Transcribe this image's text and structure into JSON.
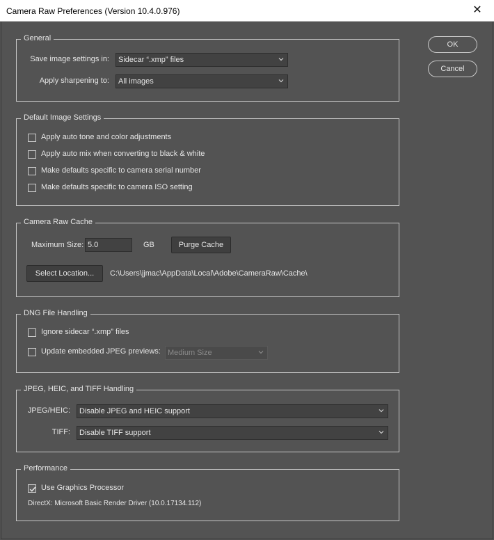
{
  "window": {
    "title": "Camera Raw Preferences  (Version 10.4.0.976)",
    "close_glyph": "✕"
  },
  "buttons": {
    "ok": "OK",
    "cancel": "Cancel"
  },
  "general": {
    "legend": "General",
    "save_label": "Save image settings in:",
    "save_value": "Sidecar “.xmp” files",
    "sharpen_label": "Apply sharpening to:",
    "sharpen_value": "All images"
  },
  "default_image": {
    "legend": "Default Image Settings",
    "items": [
      {
        "label": "Apply auto tone and color adjustments",
        "checked": false
      },
      {
        "label": "Apply auto mix when converting to black & white",
        "checked": false
      },
      {
        "label": "Make defaults specific to camera serial number",
        "checked": false
      },
      {
        "label": "Make defaults specific to camera ISO setting",
        "checked": false
      }
    ]
  },
  "cache": {
    "legend": "Camera Raw Cache",
    "max_size_label": "Maximum Size:",
    "max_size_value": "5.0",
    "unit": "GB",
    "purge_label": "Purge Cache",
    "select_location_label": "Select Location...",
    "path": "C:\\Users\\jjmac\\AppData\\Local\\Adobe\\CameraRaw\\Cache\\"
  },
  "dng": {
    "legend": "DNG File Handling",
    "ignore_label": "Ignore sidecar “.xmp” files",
    "ignore_checked": false,
    "update_label": "Update embedded JPEG previews:",
    "update_checked": false,
    "preview_value": "Medium Size"
  },
  "jpeg": {
    "legend": "JPEG, HEIC, and TIFF Handling",
    "jpeg_label": "JPEG/HEIC:",
    "jpeg_value": "Disable JPEG and HEIC support",
    "tiff_label": "TIFF:",
    "tiff_value": "Disable TIFF support"
  },
  "performance": {
    "legend": "Performance",
    "gpu_label": "Use Graphics Processor",
    "gpu_checked": true,
    "driver": "DirectX: Microsoft Basic Render Driver (10.0.17134.112)"
  }
}
